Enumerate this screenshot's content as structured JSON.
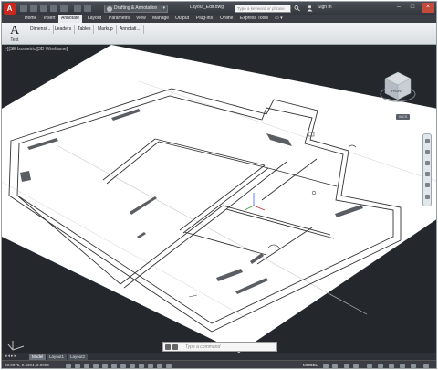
{
  "titlebar": {
    "app_button": "A",
    "workspace": "Drafting & Annotation",
    "doc_title": "Layout_Edit.dwg",
    "search_placeholder": "Type a keyword or phrase",
    "signin": "Sign In"
  },
  "tabs": [
    {
      "label": "Home"
    },
    {
      "label": "Insert"
    },
    {
      "label": "Annotate"
    },
    {
      "label": "Layout"
    },
    {
      "label": "Parametric"
    },
    {
      "label": "View"
    },
    {
      "label": "Manage"
    },
    {
      "label": "Output"
    },
    {
      "label": "Plug-ins"
    },
    {
      "label": "Online"
    },
    {
      "label": "Express Tools"
    }
  ],
  "active_tab": "Annotate",
  "ribbon": {
    "text_big": "A",
    "text_label": "Text",
    "panels": [
      {
        "label": "Dimensi..."
      },
      {
        "label": "Leaders"
      },
      {
        "label": "Tables"
      },
      {
        "label": "Markup"
      },
      {
        "label": "Annotati..."
      }
    ]
  },
  "viewport": {
    "label": "[-][SE Isometric][3D Wireframe]",
    "wcs": "WCS",
    "viewcube_face": "FRONT"
  },
  "layout_tabs": [
    {
      "label": "Model"
    },
    {
      "label": "Layout1"
    },
    {
      "label": "Layout2"
    }
  ],
  "active_layout_tab": "Model",
  "command": {
    "placeholder": "Type a command"
  },
  "statusbar": {
    "coords": "23.0075, 2.6394, 0.0000",
    "model": "MODEL"
  },
  "colors": {
    "app_red": "#c8281e",
    "background": "#24282d",
    "floor": "#ffffff"
  }
}
